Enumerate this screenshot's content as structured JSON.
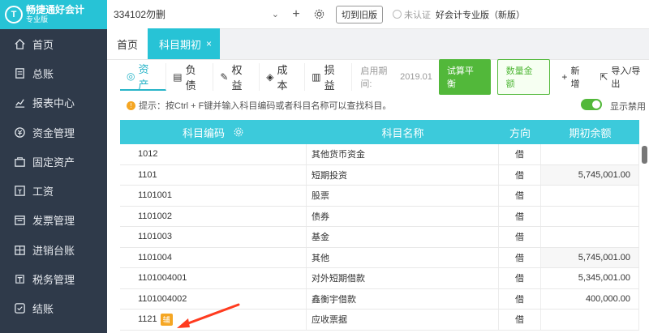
{
  "app": {
    "logo_name": "畅捷通好会计",
    "logo_sub": "专业版"
  },
  "sidebar": {
    "items": [
      {
        "label": "首页",
        "icon": "home-icon"
      },
      {
        "label": "总账",
        "icon": "ledger-icon"
      },
      {
        "label": "报表中心",
        "icon": "chart-icon"
      },
      {
        "label": "资金管理",
        "icon": "money-icon"
      },
      {
        "label": "固定资产",
        "icon": "asset-icon"
      },
      {
        "label": "工资",
        "icon": "salary-icon"
      },
      {
        "label": "发票管理",
        "icon": "invoice-icon"
      },
      {
        "label": "进销台账",
        "icon": "inventory-icon"
      },
      {
        "label": "税务管理",
        "icon": "tax-icon"
      },
      {
        "label": "结账",
        "icon": "close-account-icon"
      }
    ]
  },
  "topbar": {
    "account": "334102勿删",
    "switch_old": "切到旧版",
    "auth_status": "未认证",
    "version": "好会计专业版（新版）"
  },
  "tabs": [
    {
      "label": "首页"
    },
    {
      "label": "科目期初",
      "close": "×"
    }
  ],
  "categories": [
    {
      "label": "资产",
      "icon": "asset-tab-icon"
    },
    {
      "label": "负债",
      "icon": "liability-tab-icon"
    },
    {
      "label": "权益",
      "icon": "equity-tab-icon"
    },
    {
      "label": "成本",
      "icon": "cost-tab-icon"
    },
    {
      "label": "损益",
      "icon": "profit-tab-icon"
    }
  ],
  "toolbar": {
    "start_label": "启用期间:",
    "start_value": "2019.01",
    "trial_balance": "试算平衡",
    "quantity_amount": "数量金额",
    "add": "新增",
    "import_export": "导入/导出"
  },
  "hint": {
    "text": "提示：按Ctrl + F键并输入科目编码或者科目名称可以查找科目。",
    "toggle_label": "显示禁用",
    "toggle_on": true
  },
  "table": {
    "headers": {
      "code": "科目编码",
      "name": "科目名称",
      "direction": "方向",
      "balance": "期初余额"
    },
    "rows": [
      {
        "code": "1012",
        "name": "其他货币资金",
        "direction": "借",
        "balance": ""
      },
      {
        "code": "1101",
        "name": "短期投资",
        "direction": "借",
        "balance": "5,745,001.00"
      },
      {
        "code": "1101001",
        "name": "股票",
        "direction": "借",
        "balance": ""
      },
      {
        "code": "1101002",
        "name": "债券",
        "direction": "借",
        "balance": ""
      },
      {
        "code": "1101003",
        "name": "基金",
        "direction": "借",
        "balance": ""
      },
      {
        "code": "1101004",
        "name": "其他",
        "direction": "借",
        "balance": "5,745,001.00"
      },
      {
        "code": "1101004001",
        "name": "对外短期借款",
        "direction": "借",
        "balance": "5,345,001.00"
      },
      {
        "code": "1101004002",
        "name": "鑫衡宇借款",
        "direction": "借",
        "balance": "400,000.00"
      },
      {
        "code": "1121",
        "name": "应收票据",
        "direction": "借",
        "balance": "",
        "badge": "辅"
      }
    ]
  },
  "colors": {
    "accent": "#27c3d6",
    "sidebar": "#2f3a4a",
    "green": "#52b83a",
    "annotation": "#ff3b1f"
  }
}
